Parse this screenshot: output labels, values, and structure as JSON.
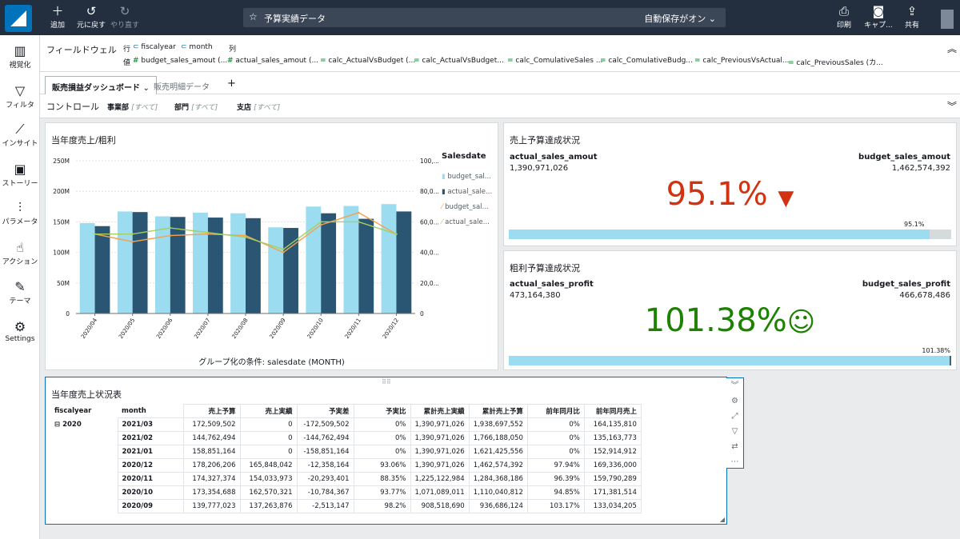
{
  "toolbar": {
    "add": "追加",
    "undo": "元に戻す",
    "redo": "やり直す",
    "analysis_title": "予算実績データ",
    "autosave": "自動保存がオン",
    "print": "印刷",
    "capture": "キャプ...",
    "share": "共有"
  },
  "sidebar": {
    "items": [
      {
        "label": "視覚化",
        "icon": "bar-chart-icon"
      },
      {
        "label": "フィルタ",
        "icon": "filter-icon"
      },
      {
        "label": "インサイト",
        "icon": "insight-icon"
      },
      {
        "label": "ストーリー",
        "icon": "story-icon"
      },
      {
        "label": "パラメータ",
        "icon": "parameter-icon"
      },
      {
        "label": "アクション",
        "icon": "action-icon"
      },
      {
        "label": "テーマ",
        "icon": "theme-icon"
      },
      {
        "label": "Settings",
        "icon": "settings-icon"
      }
    ]
  },
  "fieldwell": {
    "title": "フィールドウェル",
    "row_label": "行",
    "col_label": "列",
    "value_label": "値",
    "rows": [
      "fiscalyear",
      "month"
    ],
    "values": [
      "budget_sales_amout (...",
      "actual_sales_amout (...",
      "calc_ActualVsBudget (...",
      "calc_ActualVsBudget...",
      "calc_ComulativeSales ...",
      "calc_ComulativeBudg...",
      "calc_PreviousVsActual...",
      "calc_PreviousSales (カ..."
    ]
  },
  "tabs": {
    "active": "販売損益ダッシュボード",
    "other": "販売明細データ",
    "add": "+"
  },
  "controls": {
    "label": "コントロール",
    "items": [
      {
        "name": "事業部",
        "value": "[すべて]"
      },
      {
        "name": "部門",
        "value": "[すべて]"
      },
      {
        "name": "支店",
        "value": "[すべて]"
      }
    ]
  },
  "chart_panel": {
    "title": "当年度売上/粗利",
    "group_by": "グループ化の条件: salesdate (MONTH)",
    "legend_title": "Salesdate",
    "legend": [
      "budget_sal...",
      "actual_sale...",
      "budget_sal...",
      "actual_sale..."
    ]
  },
  "chart_data": {
    "type": "bar",
    "categories": [
      "2020/04",
      "2020/05",
      "2020/06",
      "2020/07",
      "2020/08",
      "2020/09",
      "2020/10",
      "2020/11",
      "2020/12"
    ],
    "y_ticks": [
      "0",
      "50M",
      "100M",
      "150M",
      "200M",
      "250M"
    ],
    "y2_ticks": [
      "0",
      "20,0...",
      "40,0...",
      "60,0...",
      "80,0...",
      "100,..."
    ],
    "ylim": [
      0,
      250000000
    ],
    "y2lim": [
      0,
      100000000
    ],
    "series": [
      {
        "name": "budget_sal...",
        "kind": "bar",
        "axis": "left",
        "color": "#9bdcf0",
        "values": [
          148000000,
          167000000,
          159000000,
          165000000,
          164000000,
          141000000,
          175000000,
          176000000,
          179000000
        ]
      },
      {
        "name": "actual_sale...",
        "kind": "bar",
        "axis": "left",
        "color": "#2a5674",
        "values": [
          143000000,
          166000000,
          158000000,
          157000000,
          156000000,
          140000000,
          164000000,
          155000000,
          167000000
        ]
      },
      {
        "name": "budget_sal...",
        "kind": "line",
        "axis": "right",
        "color": "#f5a04c",
        "values": [
          52000000,
          47000000,
          51000000,
          52000000,
          51000000,
          40000000,
          58000000,
          66000000,
          52000000
        ]
      },
      {
        "name": "actual_sale...",
        "kind": "line",
        "axis": "right",
        "color": "#a4d15c",
        "values": [
          52000000,
          52000000,
          56000000,
          53000000,
          50000000,
          42000000,
          60000000,
          60000000,
          52000000
        ]
      }
    ]
  },
  "kpi_sales": {
    "title": "売上予算達成状況",
    "actual_label": "actual_sales_amout",
    "actual_value": "1,390,971,026",
    "target_label": "budget_sales_amout",
    "target_value": "1,462,574,392",
    "percent": "95.1%",
    "bar_label": "95.1%",
    "progress": 0.951,
    "color": "#d13212",
    "icon": "thumbs-down-icon"
  },
  "kpi_profit": {
    "title": "粗利予算達成状況",
    "actual_label": "actual_sales_profit",
    "actual_value": "473,164,380",
    "target_label": "budget_sales_profit",
    "target_value": "466,678,486",
    "percent": "101.38%",
    "bar_label": "101.38%",
    "progress": 1.0,
    "color": "#1d8102",
    "icon": "smile-icon"
  },
  "table_panel": {
    "title": "当年度売上状況表",
    "row_headers": [
      "fiscalyear",
      "month"
    ],
    "columns": [
      "売上予算",
      "売上実績",
      "予実差",
      "予実比",
      "累計売上実績",
      "累計売上予算",
      "前年同月比",
      "前年同月売上"
    ],
    "year": "2020",
    "rows": [
      {
        "month": "2021/03",
        "cells": [
          "172,509,502",
          "0",
          "-172,509,502",
          "0%",
          "1,390,971,026",
          "1,938,697,552",
          "0%",
          "164,135,810"
        ]
      },
      {
        "month": "2021/02",
        "cells": [
          "144,762,494",
          "0",
          "-144,762,494",
          "0%",
          "1,390,971,026",
          "1,766,188,050",
          "0%",
          "135,163,773"
        ]
      },
      {
        "month": "2021/01",
        "cells": [
          "158,851,164",
          "0",
          "-158,851,164",
          "0%",
          "1,390,971,026",
          "1,621,425,556",
          "0%",
          "152,914,912"
        ]
      },
      {
        "month": "2020/12",
        "cells": [
          "178,206,206",
          "165,848,042",
          "-12,358,164",
          "93.06%",
          "1,390,971,026",
          "1,462,574,392",
          "97.94%",
          "169,336,000"
        ]
      },
      {
        "month": "2020/11",
        "cells": [
          "174,327,374",
          "154,033,973",
          "-20,293,401",
          "88.35%",
          "1,225,122,984",
          "1,284,368,186",
          "96.39%",
          "159,790,289"
        ]
      },
      {
        "month": "2020/10",
        "cells": [
          "173,354,688",
          "162,570,321",
          "-10,784,367",
          "93.77%",
          "1,071,089,011",
          "1,110,040,812",
          "94.85%",
          "171,381,514"
        ]
      },
      {
        "month": "2020/09",
        "cells": [
          "139,777,023",
          "137,263,876",
          "-2,513,147",
          "98.2%",
          "908,518,690",
          "936,686,124",
          "103.17%",
          "133,034,205"
        ]
      }
    ]
  }
}
